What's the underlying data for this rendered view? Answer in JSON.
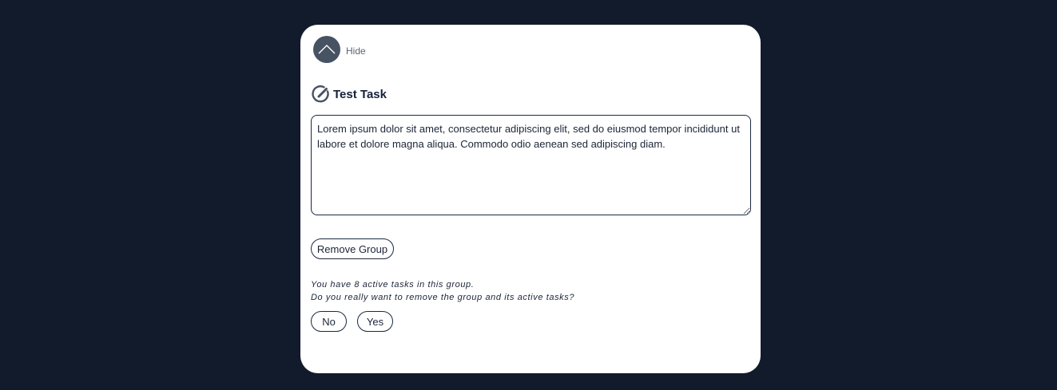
{
  "colors": {
    "background": "#111b2b",
    "card": "#ffffff",
    "accent": "#475263",
    "border": "#1b2a40",
    "text": "#1b2537"
  },
  "header": {
    "hide_icon": "chevron-up-icon",
    "hide_label": "Hide"
  },
  "task": {
    "icon": "edit-circle-icon",
    "title": "Test Task",
    "description": "Lorem ipsum dolor sit amet, consectetur adipiscing elit, sed do eiusmod tempor incididunt ut labore et dolore magna aliqua. Commodo odio aenean sed adipiscing diam."
  },
  "actions": {
    "remove_group_label": "Remove Group"
  },
  "confirm": {
    "line1": "You have 8 active tasks in this group.",
    "line2": "Do you really want to remove the group and its active tasks?",
    "no_label": "No",
    "yes_label": "Yes"
  }
}
